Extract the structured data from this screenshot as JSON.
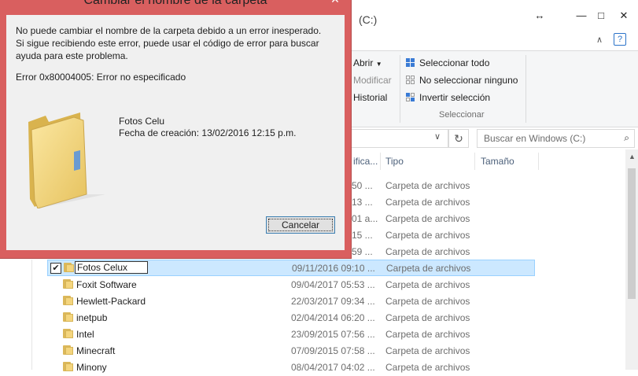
{
  "explorer": {
    "window_title": "(C:)",
    "controls": {
      "resize": "↔",
      "minimize": "—",
      "maximize": "□",
      "close": "✕"
    },
    "ribbon": {
      "open_label": "Abrir",
      "modify_label": "Modificar",
      "history_label": "Historial",
      "select_all_label": "Seleccionar todo",
      "select_none_label": "No seleccionar ninguno",
      "invert_selection_label": "Invertir selección",
      "group_label": "Seleccionar"
    },
    "search_placeholder": "Buscar en Windows  (C:)",
    "columns": {
      "modified": "ifica...",
      "type": "Tipo",
      "size": "Tamaño"
    },
    "partial_rows": [
      {
        "date": "50 ...",
        "type": "Carpeta de archivos"
      },
      {
        "date": "13 ...",
        "type": "Carpeta de archivos"
      },
      {
        "date": "01 a...",
        "type": "Carpeta de archivos"
      },
      {
        "date": "15 ...",
        "type": "Carpeta de archivos"
      },
      {
        "date": "59 ...",
        "type": "Carpeta de archivos"
      }
    ],
    "rows": [
      {
        "name": "Fotos Celux",
        "date": "09/11/2016 09:10 ...",
        "type": "Carpeta de archivos",
        "selected": true
      },
      {
        "name": "Foxit Software",
        "date": "09/04/2017 05:53 ...",
        "type": "Carpeta de archivos"
      },
      {
        "name": "Hewlett-Packard",
        "date": "22/03/2017 09:34 ...",
        "type": "Carpeta de archivos"
      },
      {
        "name": "inetpub",
        "date": "02/04/2014 06:20 ...",
        "type": "Carpeta de archivos"
      },
      {
        "name": "Intel",
        "date": "23/09/2015 07:56 ...",
        "type": "Carpeta de archivos"
      },
      {
        "name": "Minecraft",
        "date": "07/09/2015 07:58 ...",
        "type": "Carpeta de archivos"
      },
      {
        "name": "Minony",
        "date": "08/04/2017 04:02 ...",
        "type": "Carpeta de archivos"
      }
    ]
  },
  "dialog": {
    "title": "Cambiar el nombre de la carpeta",
    "close": "✕",
    "message": "No puede cambiar el nombre de la carpeta debido a un error inesperado. Si sigue recibiendo este error, puede usar el código de error para buscar ayuda para este problema.",
    "error_code": "Error 0x80004005: Error no especificado",
    "folder_name": "Fotos Celu",
    "folder_date": "Fecha de creación: 13/02/2016 12:15 p.m.",
    "cancel_label": "Cancelar"
  }
}
